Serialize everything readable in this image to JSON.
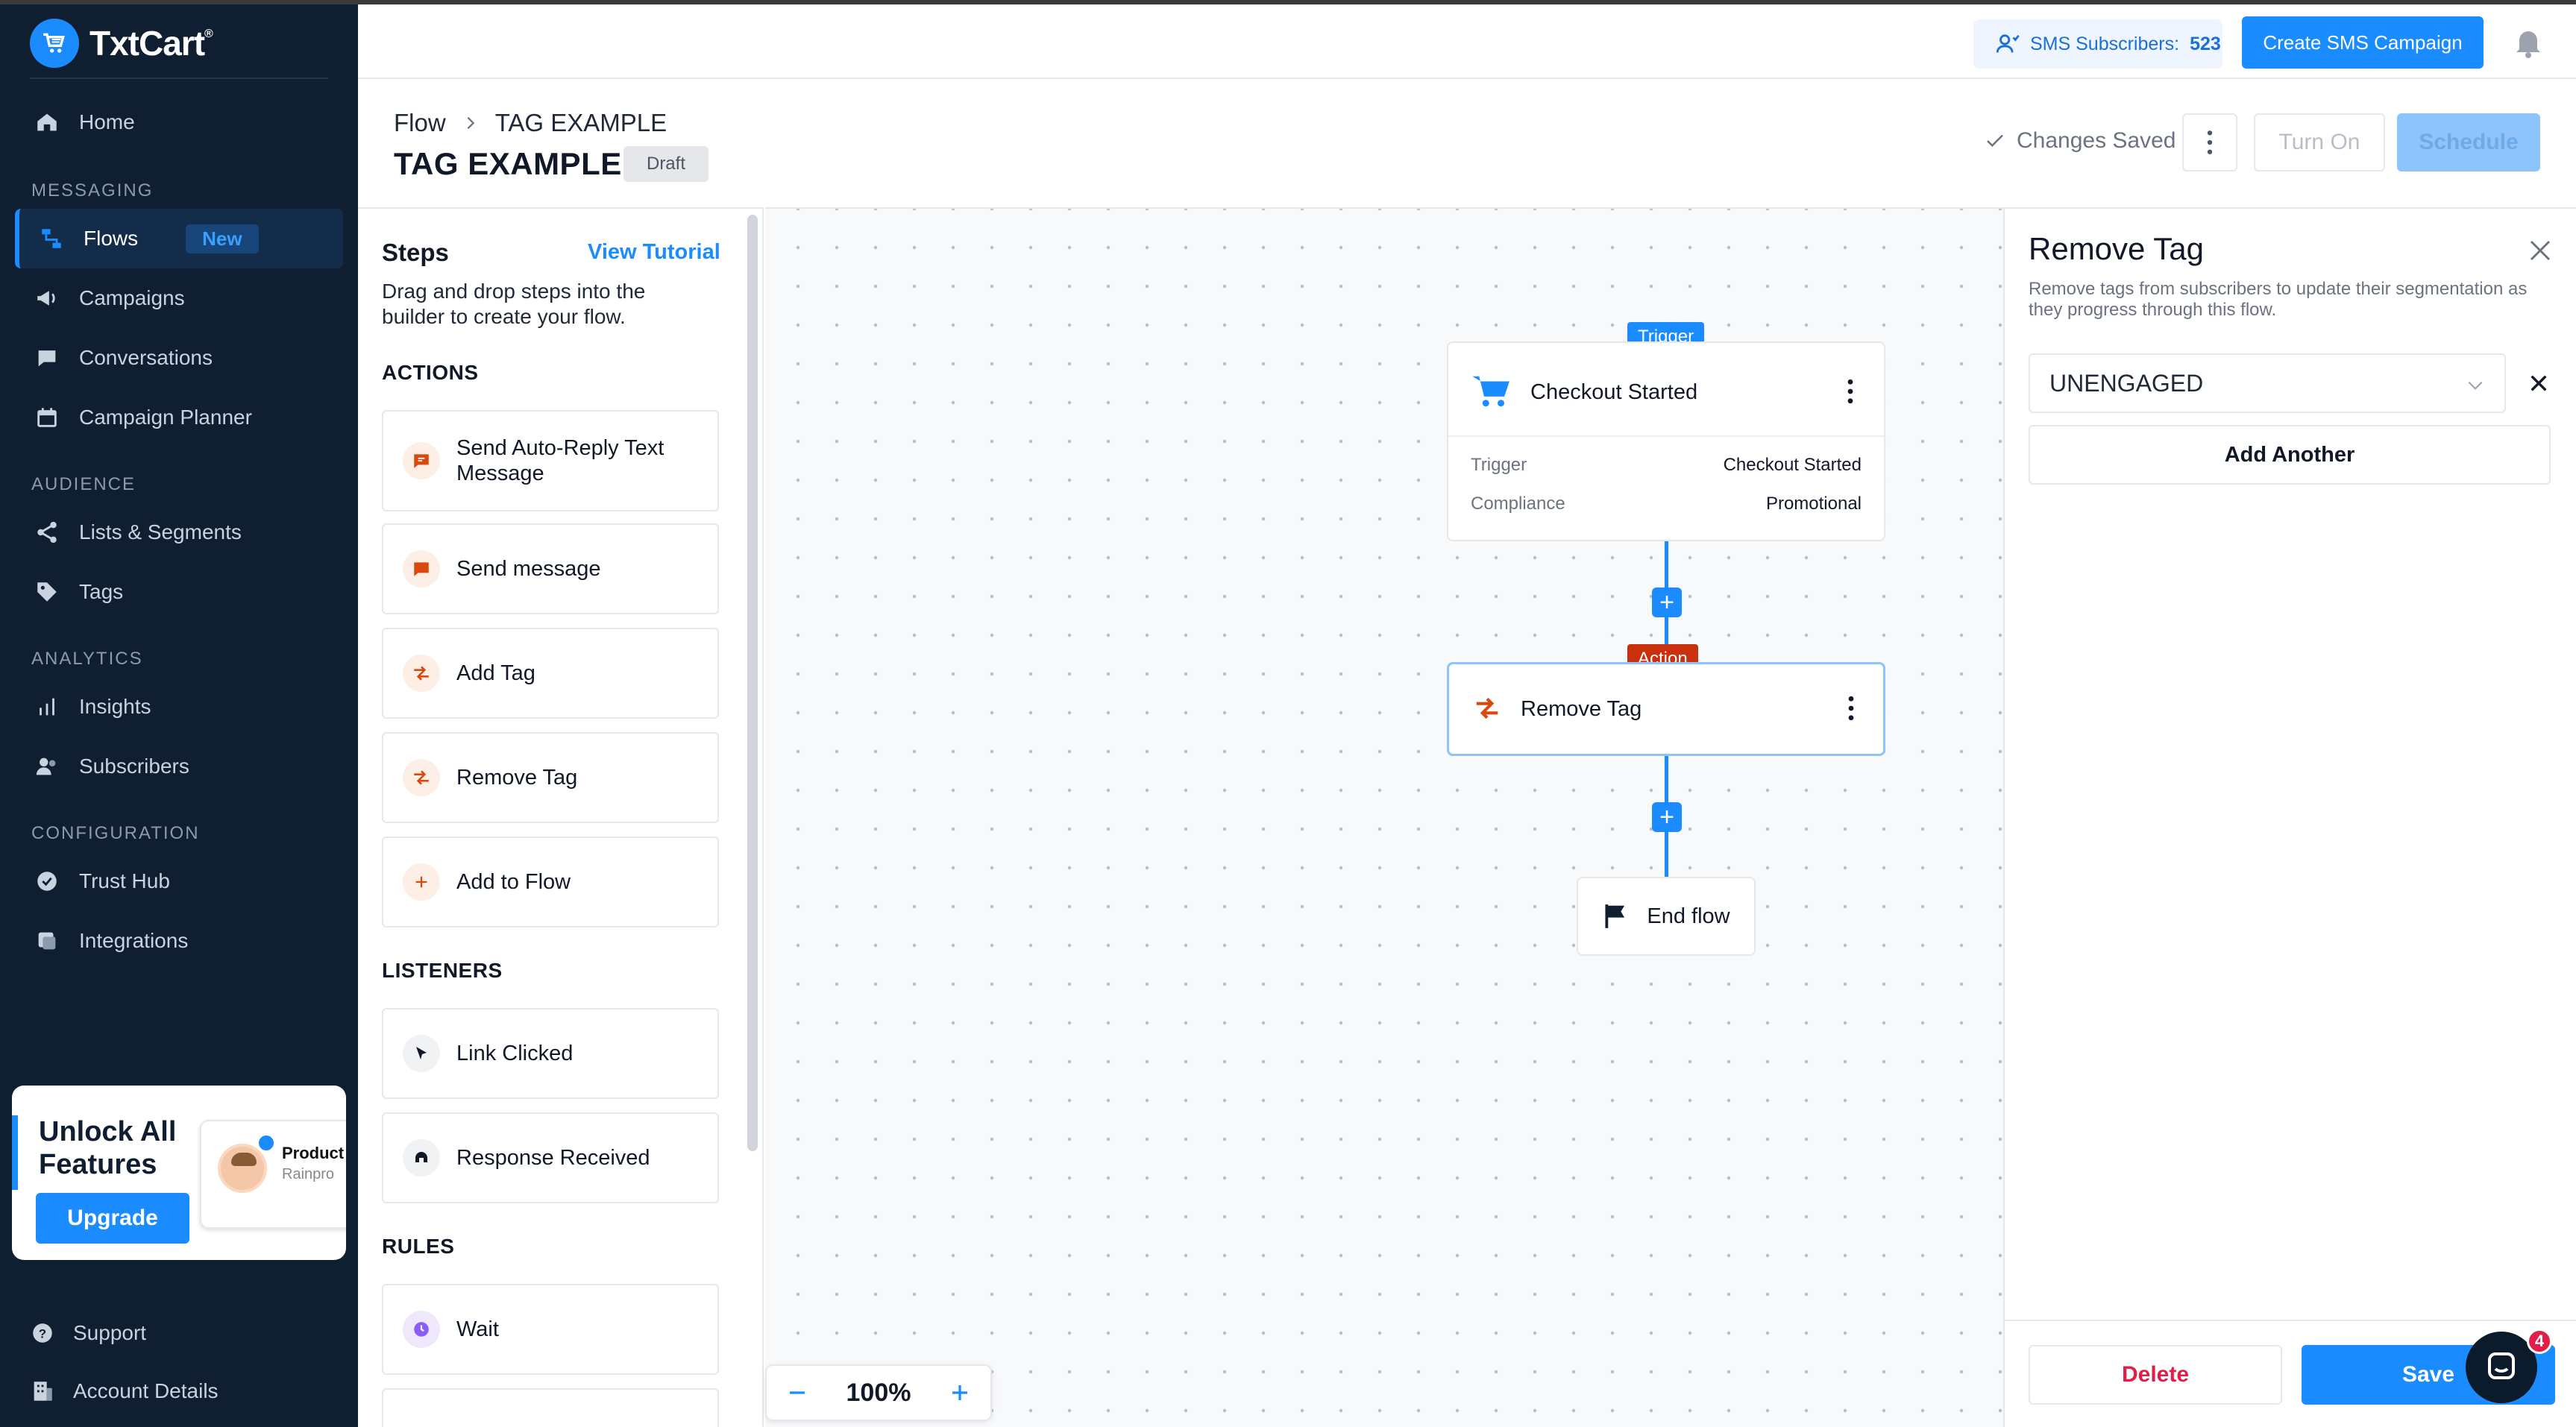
{
  "app": {
    "name": "TxtCart",
    "trademark": "®"
  },
  "sidebar": {
    "home": "Home",
    "sections": {
      "messaging": "MESSAGING",
      "audience": "AUDIENCE",
      "analytics": "ANALYTICS",
      "configuration": "CONFIGURATION"
    },
    "items": {
      "flows": "Flows",
      "flows_badge": "New",
      "campaigns": "Campaigns",
      "conversations": "Conversations",
      "campaign_planner": "Campaign Planner",
      "lists": "Lists & Segments",
      "tags": "Tags",
      "insights": "Insights",
      "subscribers": "Subscribers",
      "trust_hub": "Trust Hub",
      "integrations": "Integrations"
    },
    "upgrade": {
      "title": "Unlock All Features",
      "button": "Upgrade",
      "preview_name": "Product",
      "preview_sub": "Rainpro"
    },
    "footer": {
      "support": "Support",
      "account": "Account Details"
    }
  },
  "header": {
    "subscribers_label": "SMS Subscribers:",
    "subscribers_count": "523",
    "create_campaign": "Create SMS Campaign"
  },
  "page": {
    "breadcrumb_root": "Flow",
    "breadcrumb_current": "TAG EXAMPLE",
    "title": "TAG EXAMPLE",
    "status": "Draft",
    "saved_text": "Changes Saved",
    "turn_on": "Turn On",
    "schedule": "Schedule"
  },
  "steps": {
    "title": "Steps",
    "tutorial": "View Tutorial",
    "description": "Drag and drop steps into the builder to create your flow.",
    "actions_title": "ACTIONS",
    "actions": [
      "Send Auto-Reply Text Message",
      "Send message",
      "Add Tag",
      "Remove Tag",
      "Add to Flow"
    ],
    "listeners_title": "LISTENERS",
    "listeners": [
      "Link Clicked",
      "Response Received"
    ],
    "rules_title": "RULES",
    "rules": [
      "Wait"
    ]
  },
  "canvas": {
    "trigger_tag": "Trigger",
    "trigger_title": "Checkout Started",
    "trigger_rows": [
      {
        "label": "Trigger",
        "value": "Checkout Started"
      },
      {
        "label": "Compliance",
        "value": "Promotional"
      }
    ],
    "action_tag": "Action",
    "action_title": "Remove Tag",
    "end_title": "End flow",
    "zoom_level": "100%"
  },
  "panel": {
    "title": "Remove Tag",
    "description": "Remove tags from subscribers to update their segmentation as they progress through this flow.",
    "selected_tag": "UNENGAGED",
    "add_another": "Add Another",
    "delete": "Delete",
    "save": "Save"
  },
  "chat": {
    "unread": "4"
  },
  "colors": {
    "brand": "#1a8cff",
    "sidebar": "#0f1e30",
    "action": "#c9300e",
    "danger": "#e11d48"
  }
}
